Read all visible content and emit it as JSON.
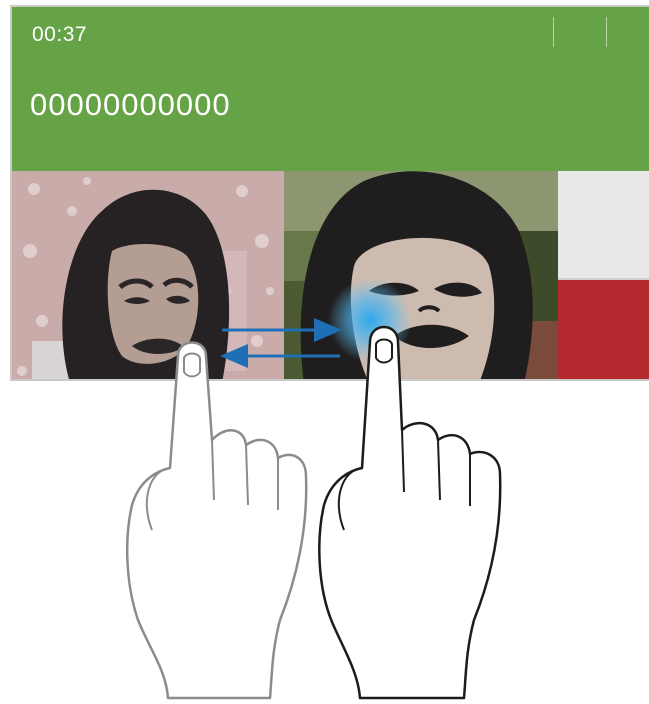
{
  "call": {
    "duration": "00:37",
    "phone_number": "00000000000"
  },
  "icons": {
    "swap_gesture": "swap-arrows-icon",
    "left_hand": "hand-pointer-icon",
    "right_hand": "hand-pointer-icon"
  },
  "colors": {
    "header_bg": "#66a346",
    "end_call_red": "#b52a2e",
    "arrow_blue": "#1e6fb5",
    "touch_glow": "#2fa8ee"
  }
}
